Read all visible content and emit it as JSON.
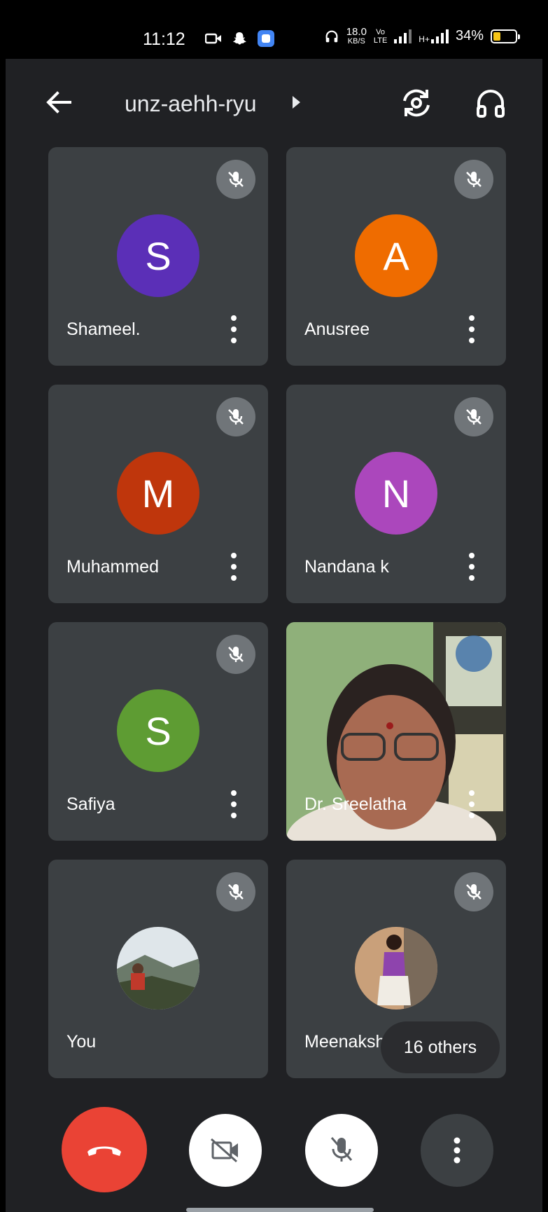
{
  "status_bar": {
    "time": "11:12",
    "net_speed_value": "18.0",
    "net_speed_unit": "KB/S",
    "volte_top": "Vo",
    "volte_bottom": "LTE",
    "network_type": "H+",
    "battery": "34%",
    "battery_level": 0.34
  },
  "header": {
    "meeting_code": "unz-aehh-ryu"
  },
  "participants": [
    {
      "name": "Shameel.",
      "initial": "S",
      "color": "#5b2fb7",
      "muted": true
    },
    {
      "name": "Anusree",
      "initial": "A",
      "color": "#ef6c00",
      "muted": true
    },
    {
      "name": "Muhammed",
      "initial": "M",
      "color": "#bf360c",
      "muted": true
    },
    {
      "name": "Nandana k",
      "initial": "N",
      "color": "#ab47bc",
      "muted": true
    },
    {
      "name": "Safiya",
      "initial": "S",
      "color": "#5e9c33",
      "muted": true
    },
    {
      "name": "Dr. Sreelatha",
      "initial": "",
      "color": "#6a8a5c",
      "muted": false
    },
    {
      "name": "You",
      "initial": "",
      "color": "#8aa0b0",
      "muted": true
    },
    {
      "name": "Meenaksh",
      "initial": "",
      "color": "#b08060",
      "muted": true
    }
  ],
  "others_label": "16 others",
  "controls": {
    "end_call_color": "#ea4335"
  }
}
